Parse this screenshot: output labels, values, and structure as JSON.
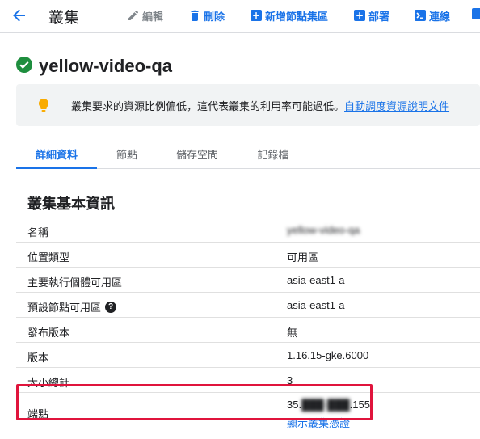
{
  "toolbar": {
    "title": "叢集",
    "edit_label": "編輯",
    "delete_label": "刪除",
    "add_node_pool_label": "新增節點集區",
    "deploy_label": "部署",
    "connect_label": "連線"
  },
  "cluster": {
    "name": "yellow-video-qa",
    "status": "running"
  },
  "notice": {
    "message": "叢集要求的資源比例偏低，這代表叢集的利用率可能過低。",
    "link": "自動調度資源說明文件"
  },
  "tabs": [
    {
      "label": "詳細資料",
      "active": true
    },
    {
      "label": "節點",
      "active": false
    },
    {
      "label": "儲存空間",
      "active": false
    },
    {
      "label": "記錄檔",
      "active": false
    }
  ],
  "section": {
    "title": "叢集基本資訊",
    "rows": [
      {
        "key": "名稱",
        "value": "yellow-video-qa"
      },
      {
        "key": "位置類型",
        "value": "可用區"
      },
      {
        "key": "主要執行個體可用區",
        "value": "asia-east1-a"
      },
      {
        "key": "預設節點可用區",
        "value": "asia-east1-a"
      },
      {
        "key": "發布版本",
        "value": "無"
      },
      {
        "key": "版本",
        "value": "1.16.15-gke.6000"
      },
      {
        "key": "大小總計",
        "value": "3"
      },
      {
        "key": "端點",
        "value": "35.",
        "value_end": ".155",
        "link": "顯示叢集憑證"
      }
    ]
  },
  "colors": {
    "accent": "#1a73e8",
    "success": "#1e8e3e",
    "highlight": "#e0143c",
    "warning": "#f9ab00"
  }
}
